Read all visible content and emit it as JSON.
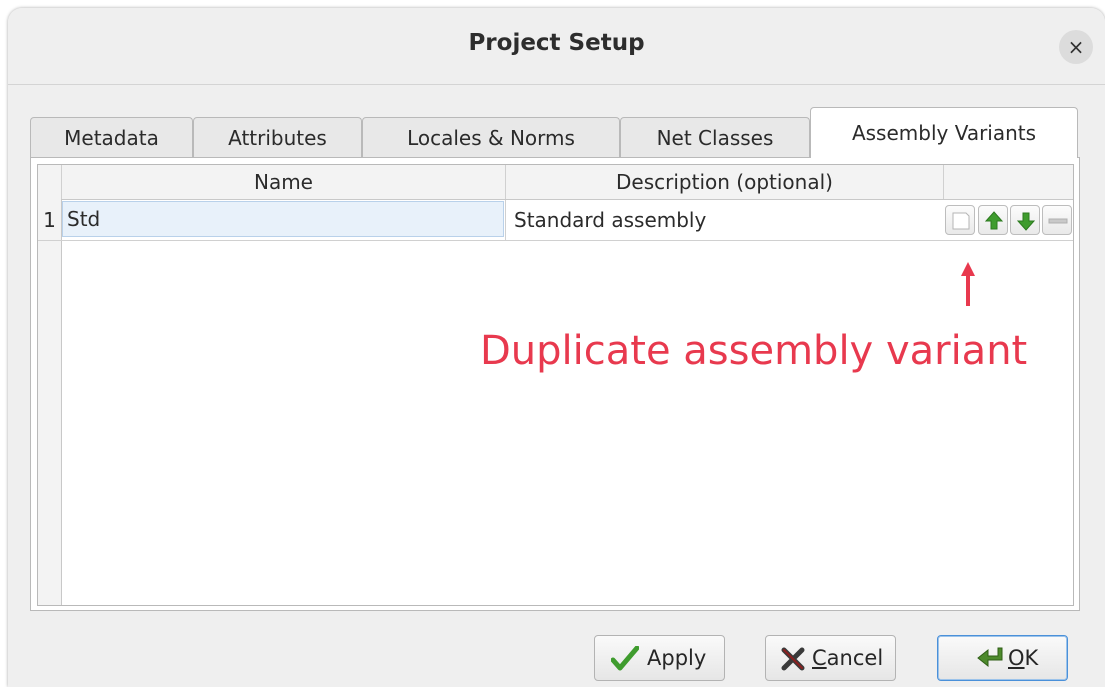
{
  "window": {
    "title": "Project Setup",
    "close_glyph": "×"
  },
  "tabs": [
    {
      "label": "Metadata",
      "active": false
    },
    {
      "label": "Attributes",
      "active": false
    },
    {
      "label": "Locales & Norms",
      "active": false
    },
    {
      "label": "Net Classes",
      "active": false
    },
    {
      "label": "Assembly Variants",
      "active": true
    }
  ],
  "table": {
    "headers": {
      "name": "Name",
      "description": "Description (optional)"
    },
    "rows": [
      {
        "number": "1",
        "name": "Std",
        "description": "Standard assembly"
      }
    ],
    "row_actions": [
      {
        "icon": "duplicate-icon"
      },
      {
        "icon": "move-up-icon"
      },
      {
        "icon": "move-down-icon"
      },
      {
        "icon": "remove-icon"
      }
    ]
  },
  "annotation": {
    "text": "Duplicate assembly variant",
    "color": "#e8394e"
  },
  "buttons": {
    "apply": {
      "label": "Apply",
      "icon": "checkmark-icon"
    },
    "cancel": {
      "prefix": "",
      "mnemonic": "C",
      "rest": "ancel",
      "icon": "cancel-x-icon"
    },
    "ok": {
      "mnemonic": "O",
      "rest": "K",
      "icon": "ok-arrow-icon"
    }
  },
  "colors": {
    "accent_green": "#3f9c2e",
    "annotation_red": "#e8394e",
    "selection_blue": "#e8f1fa"
  }
}
